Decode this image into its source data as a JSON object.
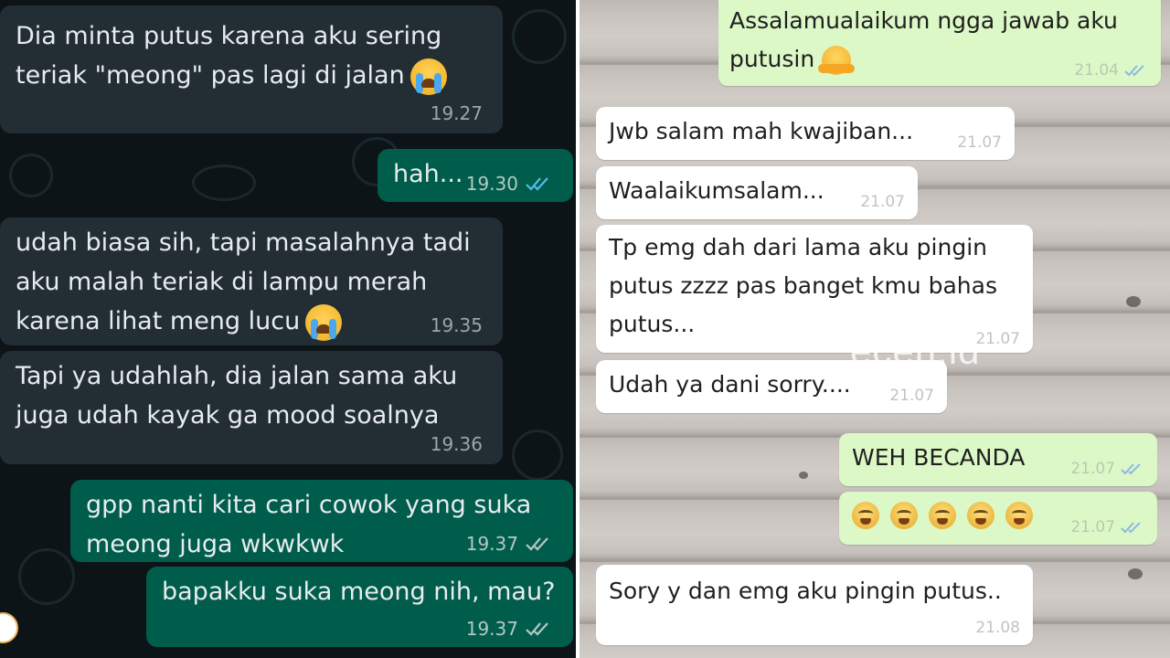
{
  "left_chat": {
    "messages": [
      {
        "dir": "in",
        "text": "Dia minta putus karena aku sering\nteriak \"meong\" pas lagi di jalan",
        "time": "19.27",
        "emoji": "loudly-crying-face-icon"
      },
      {
        "dir": "out",
        "text": "hah...",
        "time": "19.30",
        "ticks": "read"
      },
      {
        "dir": "in",
        "text": "udah biasa sih, tapi masalahnya tadi\naku malah teriak di lampu merah\nkarena lihat meng lucu",
        "time": "19.35",
        "emoji": "loudly-crying-face-icon"
      },
      {
        "dir": "in",
        "text": "Tapi ya udahlah, dia jalan sama aku\njuga udah kayak ga mood soalnya",
        "time": "19.36"
      },
      {
        "dir": "out",
        "text": "gpp nanti kita cari cowok yang suka\nmeong juga wkwkwk",
        "time": "19.37",
        "ticks": "delivered"
      },
      {
        "dir": "out",
        "text": "bapakku suka meong nih, mau?",
        "time": "19.37",
        "ticks": "delivered"
      }
    ]
  },
  "right_chat": {
    "watermark": "ecéh.id",
    "messages": [
      {
        "dir": "out",
        "text": "Assalamualaikum ngga jawab aku\nputusin",
        "time": "21.04",
        "ticks": "read",
        "emoji": "hugging-face-icon"
      },
      {
        "dir": "in",
        "text": "Jwb salam mah kwajiban...",
        "time": "21.07"
      },
      {
        "dir": "in",
        "text": "Waalaikumsalam...",
        "time": "21.07"
      },
      {
        "dir": "in",
        "text": "Tp emg dah dari lama aku pingin\nputus zzzz pas banget kmu bahas\nputus...",
        "time": "21.07"
      },
      {
        "dir": "in",
        "text": "Udah ya dani sorry....",
        "time": "21.07"
      },
      {
        "dir": "out",
        "text": "WEH BECANDA",
        "time": "21.07",
        "ticks": "read"
      },
      {
        "dir": "out",
        "emoji_row": [
          "drooling-face-icon",
          "drooling-face-icon",
          "drooling-face-icon",
          "drooling-face-icon",
          "drooling-face-icon"
        ],
        "time": "21.07",
        "ticks": "read"
      },
      {
        "dir": "in",
        "text": "Sory y dan emg aku pingin putus..",
        "time": "21.08"
      }
    ]
  },
  "colors": {
    "left_bg": "#0d1418",
    "left_in_bubble": "#232d34",
    "left_out_bubble": "#005c4b",
    "right_in_bubble": "#ffffff",
    "right_out_bubble": "#dcf8c6",
    "read_tick_blue": "#53bdeb"
  }
}
